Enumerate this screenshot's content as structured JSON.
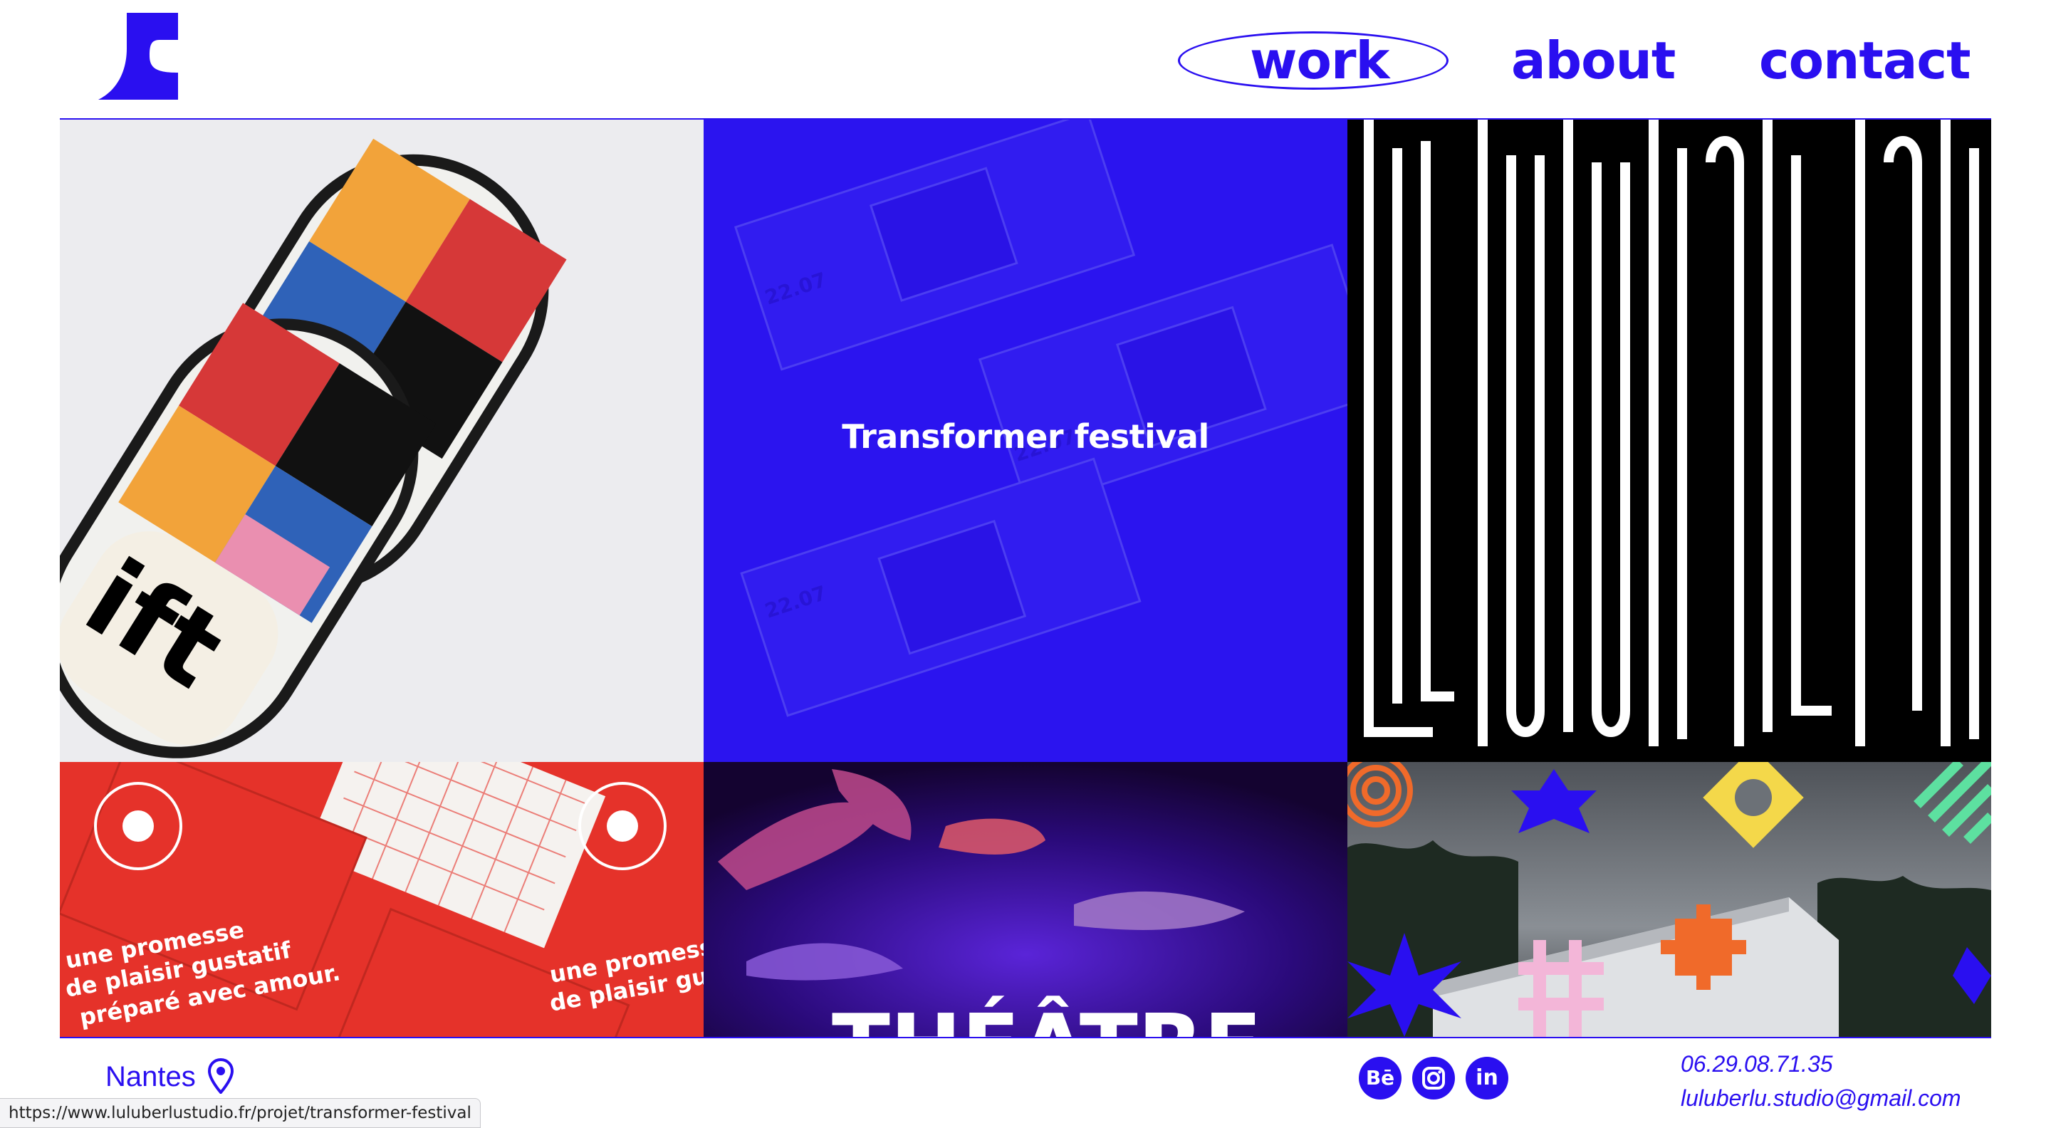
{
  "nav": {
    "items": [
      {
        "label": "work",
        "active": true
      },
      {
        "label": "about"
      },
      {
        "label": "contact"
      }
    ]
  },
  "projects": [
    {
      "title": "",
      "image": "slip-on-shoes"
    },
    {
      "title": "Transformer festival",
      "image": "festival-tickets"
    },
    {
      "title": "",
      "image": "luminerie-poster"
    },
    {
      "title": "",
      "image": "mamie-boulette-cards"
    },
    {
      "title": "",
      "image": "theatre-dancers"
    },
    {
      "title": "",
      "image": "geometric-shapes-building"
    }
  ],
  "footer": {
    "location": "Nantes",
    "social": [
      "behance-icon",
      "instagram-icon",
      "linkedin-icon"
    ],
    "behance_label": "Bē",
    "linkedin_label": "in",
    "phone": "06.29.08.71.35",
    "email": "luluberlu.studio@gmail.com"
  },
  "status_bar": {
    "url": "https://www.luluberlustudio.fr/projet/transformer-festival"
  },
  "colors": {
    "brand_blue": "#2a0ff0",
    "red": "#e5322a",
    "black": "#000000"
  }
}
